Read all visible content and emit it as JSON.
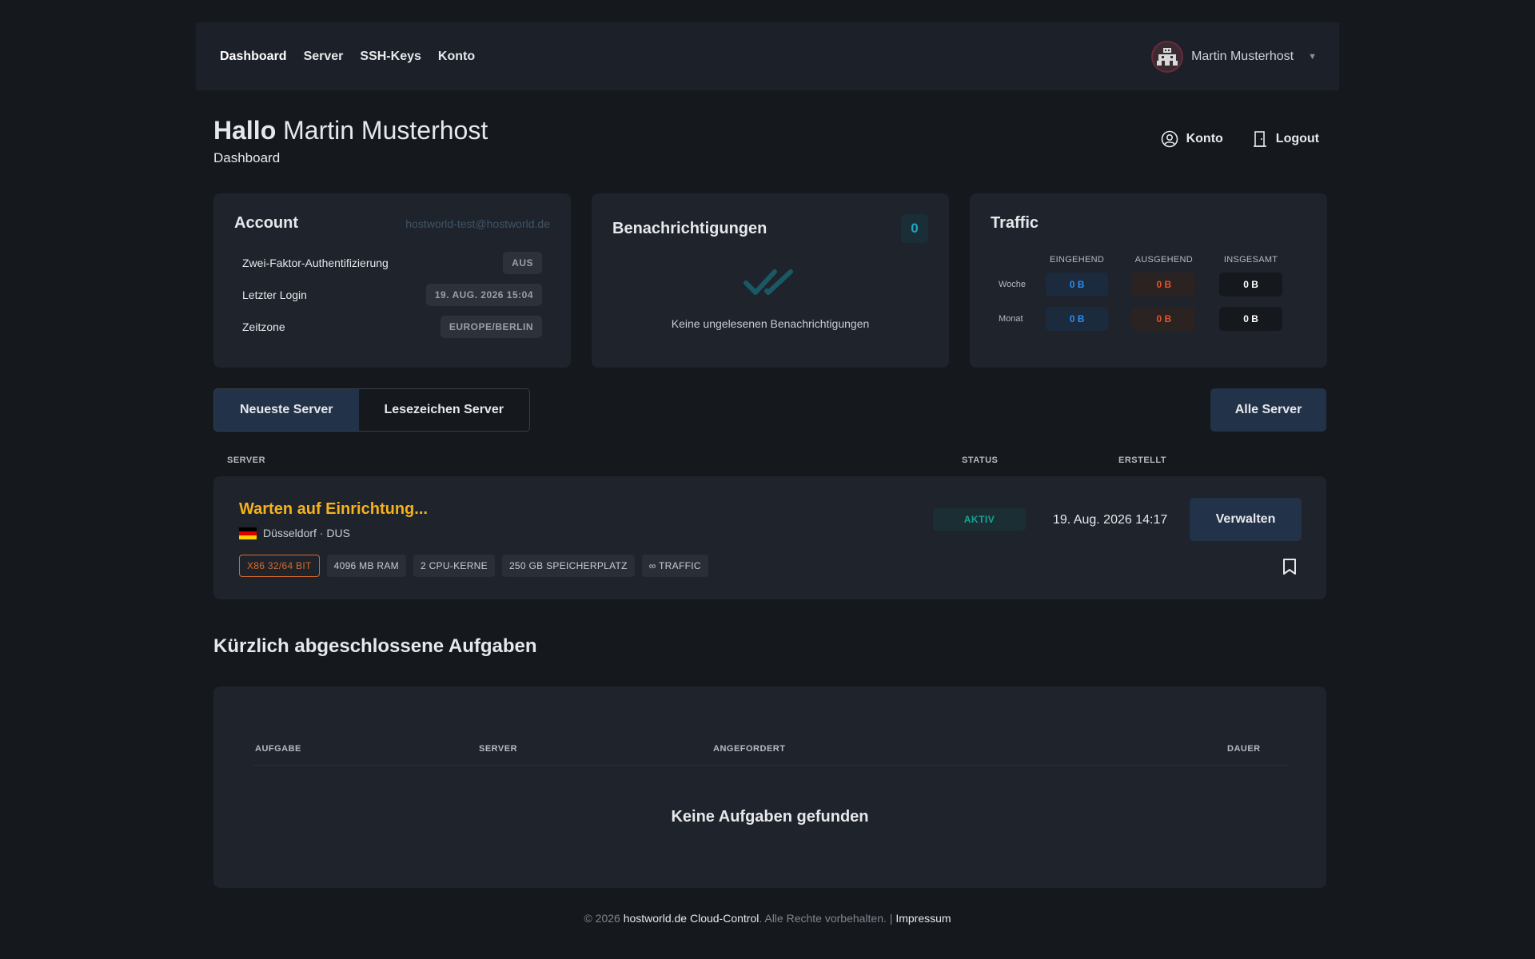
{
  "nav": {
    "links": [
      "Dashboard",
      "Server",
      "SSH-Keys",
      "Konto"
    ],
    "user_name": "Martin Musterhost"
  },
  "greeting": {
    "hello": "Hallo",
    "name": "Martin Musterhost",
    "subtitle": "Dashboard",
    "account_label": "Konto",
    "logout_label": "Logout"
  },
  "account": {
    "title": "Account",
    "email": "hostworld-test@hostworld.de",
    "rows": [
      {
        "label": "Zwei-Faktor-Authentifizierung",
        "value": "AUS"
      },
      {
        "label": "Letzter Login",
        "value": "19. AUG. 2026 15:04"
      },
      {
        "label": "Zeitzone",
        "value": "EUROPE/BERLIN"
      }
    ]
  },
  "notifications": {
    "title": "Benachrichtigungen",
    "count": "0",
    "empty_text": "Keine ungelesenen Benachrichtigungen",
    "icon": "double-check-icon"
  },
  "traffic": {
    "title": "Traffic",
    "headers": [
      "EINGEHEND",
      "AUSGEHEND",
      "INSGESAMT"
    ],
    "rows": [
      {
        "label": "Woche",
        "in": "0 B",
        "out": "0 B",
        "total": "0 B"
      },
      {
        "label": "Monat",
        "in": "0 B",
        "out": "0 B",
        "total": "0 B"
      }
    ]
  },
  "server_tabs": {
    "tabs": [
      "Neueste Server",
      "Lesezeichen Server"
    ],
    "active": 0,
    "all_button": "Alle Server"
  },
  "server_table": {
    "headers": {
      "server": "SERVER",
      "status": "STATUS",
      "created": "ERSTELLT"
    },
    "rows": [
      {
        "name": "Warten auf Einrichtung...",
        "location": "Düsseldorf · DUS",
        "specs": [
          "X86 32/64 BIT",
          "4096 MB RAM",
          "2 CPU-KERNE",
          "250 GB SPEICHERPLATZ",
          "∞ TRAFFIC"
        ],
        "status": "AKTIV",
        "created": "19. Aug. 2026 14:17",
        "manage_label": "Verwalten"
      }
    ]
  },
  "tasks": {
    "title": "Kürzlich abgeschlossene Aufgaben",
    "headers": {
      "task": "AUFGABE",
      "server": "SERVER",
      "requested": "ANGEFORDERT",
      "duration": "DAUER"
    },
    "empty_text": "Keine Aufgaben gefunden"
  },
  "footer": {
    "copyright": "© 2026",
    "brand": "hostworld.de Cloud-Control",
    "rights": ". Alle Rechte vorbehalten. |",
    "impressum": "Impressum"
  },
  "colors": {
    "background": "#15181d",
    "card": "#1f232b",
    "accent_button": "#223248",
    "server_name": "#f6b21b",
    "status_active": "#1aa394"
  }
}
